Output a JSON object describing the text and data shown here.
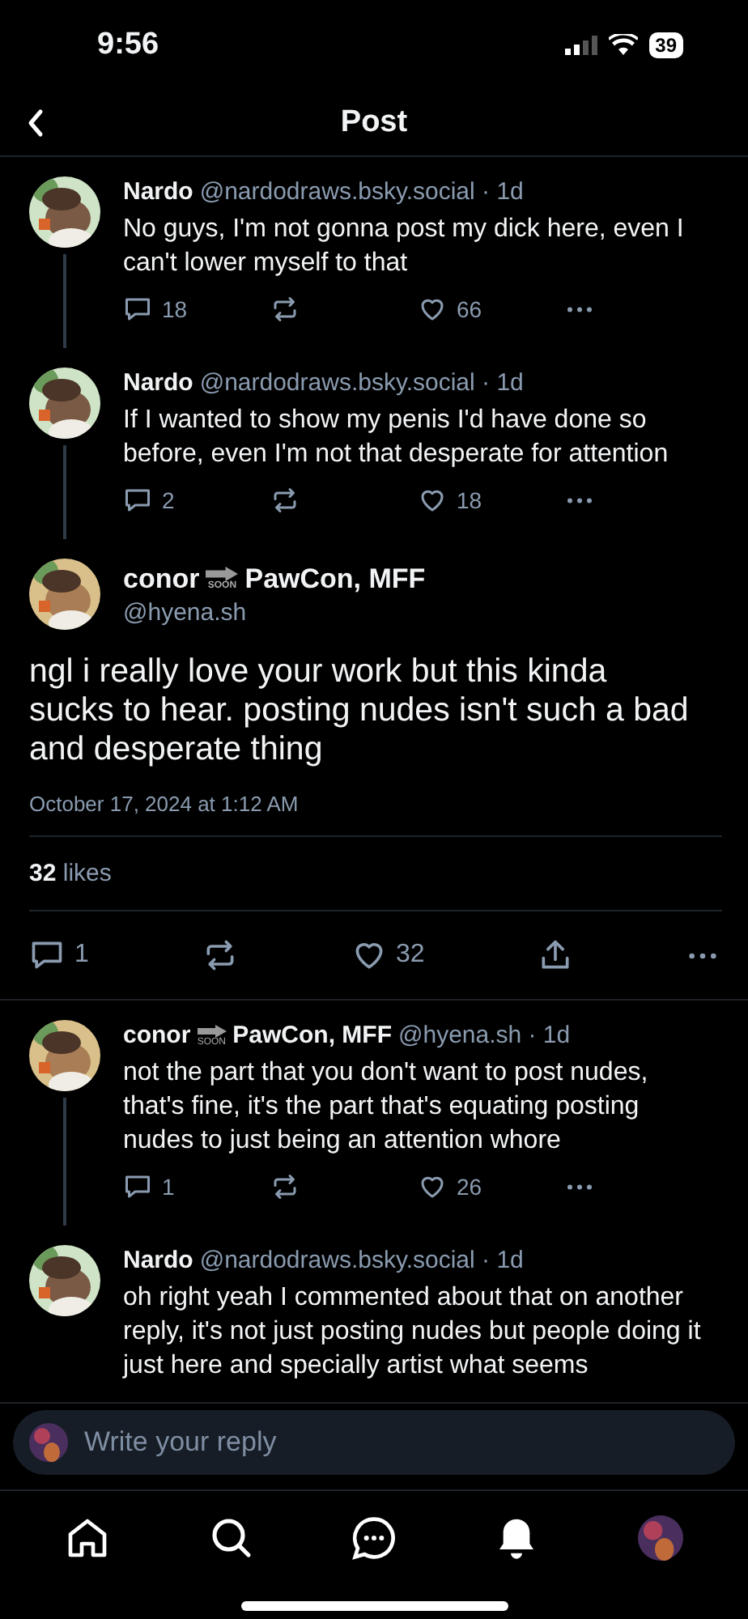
{
  "status_bar": {
    "time": "9:56",
    "battery": "39"
  },
  "header": {
    "title": "Post"
  },
  "posts": [
    {
      "kind": "reply",
      "name": "Nardo",
      "meta": "@nardodraws.bsky.social · 1d",
      "text": "No guys, I'm not gonna post my dick here, even I can't lower myself to that",
      "replies": "18",
      "likes": "66"
    },
    {
      "kind": "reply",
      "name": "Nardo",
      "meta": "@nardodraws.bsky.social · 1d",
      "text": "If I wanted to show my penis I'd have done so before, even I'm not that desperate for attention",
      "replies": "2",
      "likes": "18"
    },
    {
      "kind": "main",
      "name": "conor",
      "badge": "SOON",
      "name_rest": "PawCon, MFF",
      "meta": "@hyena.sh",
      "text": "ngl i really love your work but this kinda sucks to hear. posting nudes isn't such a bad and desperate thing",
      "date": "October 17, 2024 at 1:12 AM",
      "like_count": "32",
      "like_word": "likes",
      "replies": "1",
      "likes": "32"
    },
    {
      "kind": "reply",
      "name": "conor",
      "badge": "SOON",
      "name_rest": "PawCon, MFF",
      "meta": "@hyena.sh · 1d",
      "text": "not the part that you don't want to post nudes, that's fine, it's the part that's equating posting nudes to just being an attention whore",
      "replies": "1",
      "likes": "26"
    },
    {
      "kind": "reply",
      "name": "Nardo",
      "meta": "@nardodraws.bsky.social · 1d",
      "text": "oh right yeah I commented about that on another reply, it's not just posting nudes but people doing it just here and specially artist what seems"
    }
  ],
  "reply_field": {
    "placeholder": "Write your reply"
  }
}
